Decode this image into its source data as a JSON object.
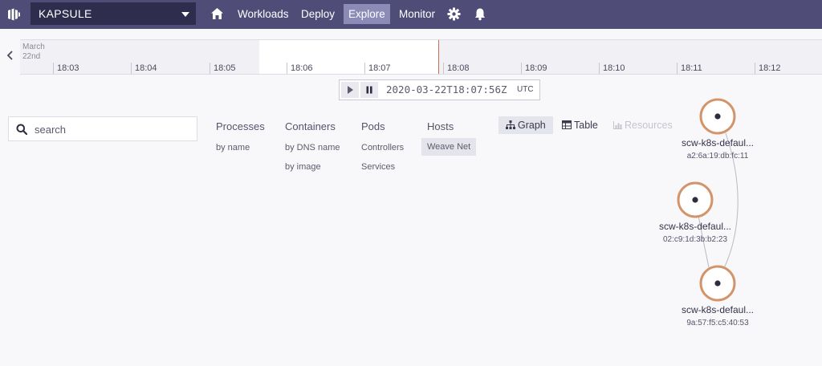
{
  "app": {
    "cluster": "KAPSULE",
    "nav": [
      {
        "label": "Workloads",
        "active": false
      },
      {
        "label": "Deploy",
        "active": false
      },
      {
        "label": "Explore",
        "active": true
      },
      {
        "label": "Monitor",
        "active": false
      }
    ]
  },
  "timeline": {
    "month": "March",
    "day": "22nd",
    "ticks": [
      "18:03",
      "18:04",
      "18:05",
      "18:06",
      "18:07",
      "18:08",
      "18:09",
      "18:10",
      "18:11",
      "18:12"
    ],
    "timestamp": "2020-03-22T18:07:56Z",
    "timezone": "UTC"
  },
  "search": {
    "placeholder": "search"
  },
  "topologies": [
    {
      "label": "Processes",
      "subs": [
        "by name"
      ]
    },
    {
      "label": "Containers",
      "subs": [
        "by DNS name",
        "by image"
      ]
    },
    {
      "label": "Pods",
      "subs": [
        "Controllers",
        "Services"
      ]
    },
    {
      "label": "Hosts",
      "subs": [
        "Weave Net"
      ],
      "active_sub": "Weave Net"
    }
  ],
  "view_modes": [
    {
      "label": "Graph",
      "active": true,
      "icon": "graph-icon"
    },
    {
      "label": "Table",
      "active": false,
      "icon": "table-icon"
    },
    {
      "label": "Resources",
      "active": false,
      "disabled": true,
      "icon": "resources-icon"
    }
  ],
  "graph": {
    "node_color": "#d4946a",
    "nodes": [
      {
        "label": "scw-k8s-defaul...",
        "sub": "a2:6a:19:db:fc:11"
      },
      {
        "label": "scw-k8s-defaul...",
        "sub": "02:c9:1d:3b:b2:23"
      },
      {
        "label": "scw-k8s-defaul...",
        "sub": "9a:57:f5:c5:40:53"
      }
    ]
  },
  "colors": {
    "topbar": "#4f4d78",
    "accent": "#c5714c",
    "active_nav": "#8c8bb8"
  }
}
